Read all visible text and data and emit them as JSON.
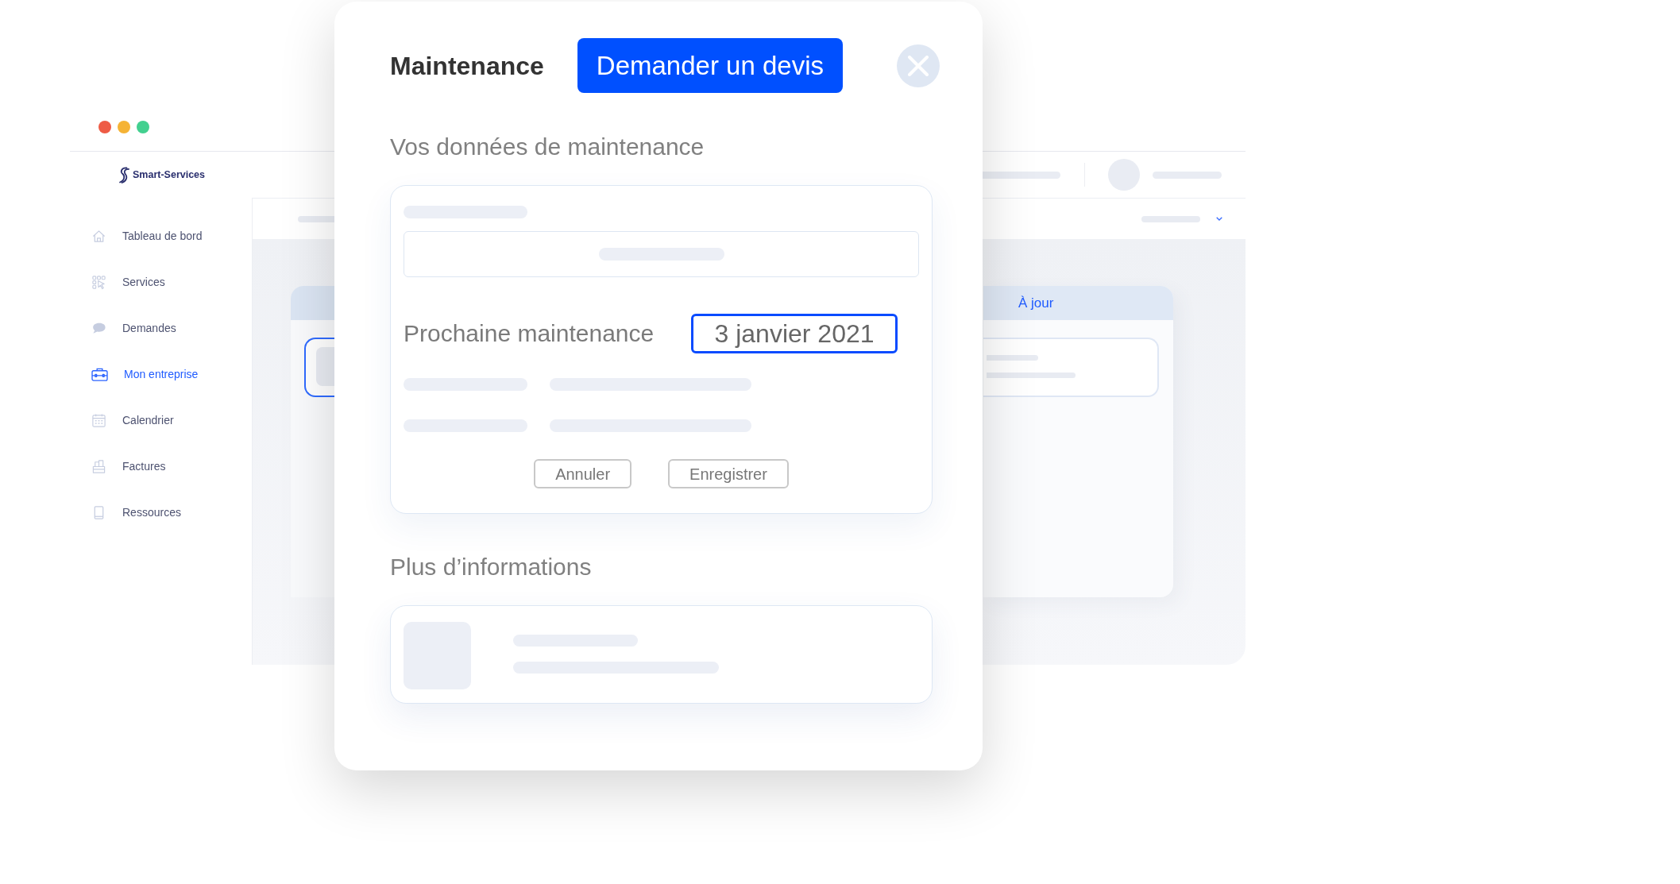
{
  "window": {
    "controls": [
      {
        "color": "#ee5b45"
      },
      {
        "color": "#f5b335"
      },
      {
        "color": "#42d08f"
      }
    ]
  },
  "sidebar": {
    "logo": "Smart-Services",
    "items": [
      {
        "label": "Tableau de bord",
        "selected": false
      },
      {
        "label": "Services",
        "selected": false
      },
      {
        "label": "Demandes",
        "selected": false
      },
      {
        "label": "Mon entreprise",
        "selected": true
      },
      {
        "label": "Calendrier",
        "selected": false
      },
      {
        "label": "Factures",
        "selected": false
      },
      {
        "label": "Ressources",
        "selected": false
      }
    ]
  },
  "board": {
    "columns": [
      {
        "cards": [
          {
            "selected": true
          }
        ]
      },
      {
        "title": "À jour",
        "cards": [
          {
            "selected": false
          }
        ]
      }
    ]
  },
  "modal": {
    "title": "Maintenance",
    "action_button": "Demander un devis",
    "sections": [
      {
        "kind": "form",
        "title": "Vos données de maintenance",
        "field_label": "Prochaine maintenance",
        "field_value": "3 janvier 2021",
        "field_focused": true,
        "buttons": [
          "Annuler",
          "Enregistrer"
        ]
      },
      {
        "kind": "info",
        "title": "Plus d’informations"
      }
    ]
  }
}
